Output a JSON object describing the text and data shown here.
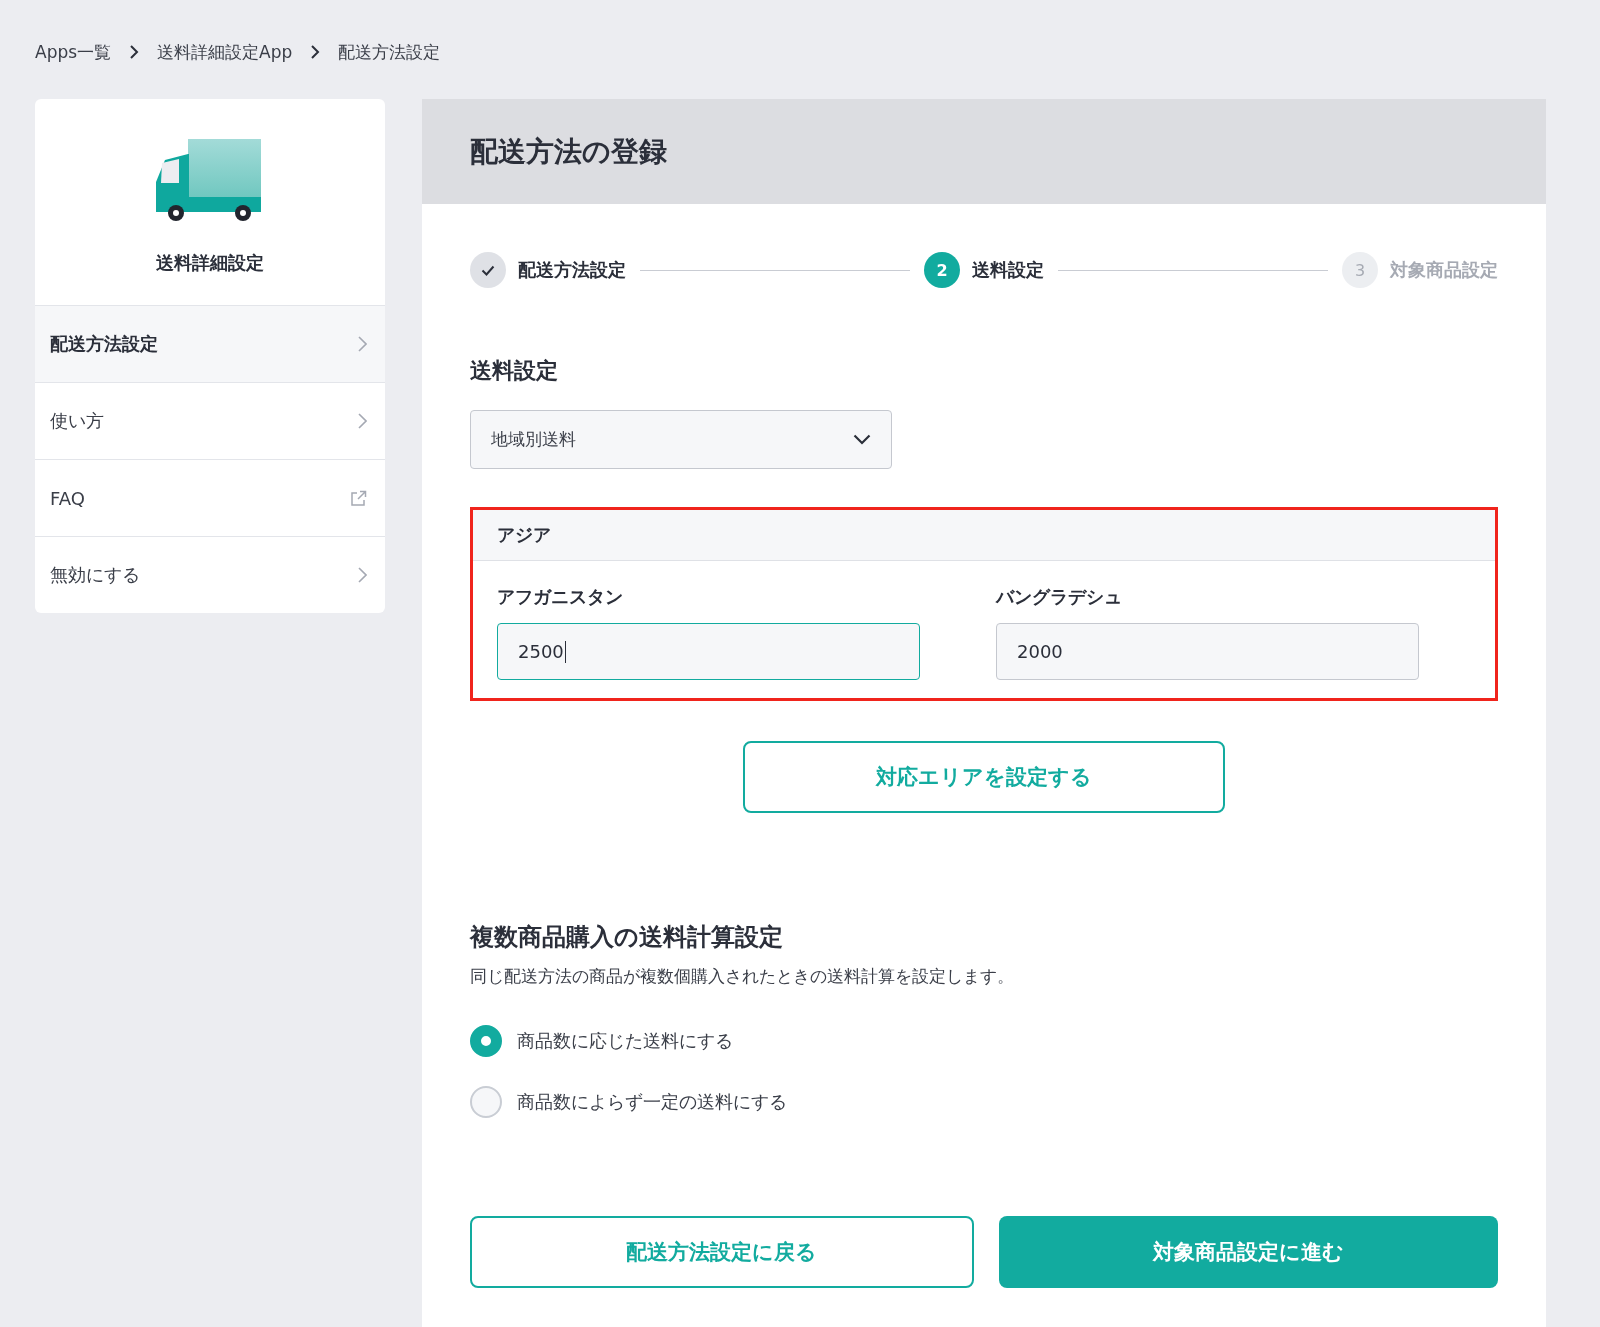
{
  "breadcrumb": [
    "Apps一覧",
    "送料詳細設定App",
    "配送方法設定"
  ],
  "sidebar": {
    "title": "送料詳細設定",
    "items": [
      {
        "label": "配送方法設定",
        "selected": true,
        "kind": "chevron"
      },
      {
        "label": "使い方",
        "selected": false,
        "kind": "chevron"
      },
      {
        "label": "FAQ",
        "selected": false,
        "kind": "external"
      },
      {
        "label": "無効にする",
        "selected": false,
        "kind": "chevron"
      }
    ]
  },
  "page_title": "配送方法の登録",
  "steps": [
    {
      "label": "配送方法設定",
      "kind": "done"
    },
    {
      "number": "2",
      "label": "送料設定",
      "kind": "current"
    },
    {
      "number": "3",
      "label": "対象商品設定",
      "kind": "todo"
    }
  ],
  "shipping": {
    "title": "送料設定",
    "select_value": "地域別送料",
    "region": {
      "title": "アジア",
      "fields": [
        {
          "label": "アフガニスタン",
          "value": "2500",
          "focused": true
        },
        {
          "label": "バングラデシュ",
          "value": "2000",
          "focused": false
        }
      ]
    },
    "area_button": "対応エリアを設定する"
  },
  "multi": {
    "title": "複数商品購入の送料計算設定",
    "description": "同じ配送方法の商品が複数個購入されたときの送料計算を設定します。",
    "options": [
      {
        "label": "商品数に応じた送料にする",
        "selected": true
      },
      {
        "label": "商品数によらず一定の送料にする",
        "selected": false
      }
    ]
  },
  "buttons": {
    "back": "配送方法設定に戻る",
    "next": "対象商品設定に進む"
  }
}
